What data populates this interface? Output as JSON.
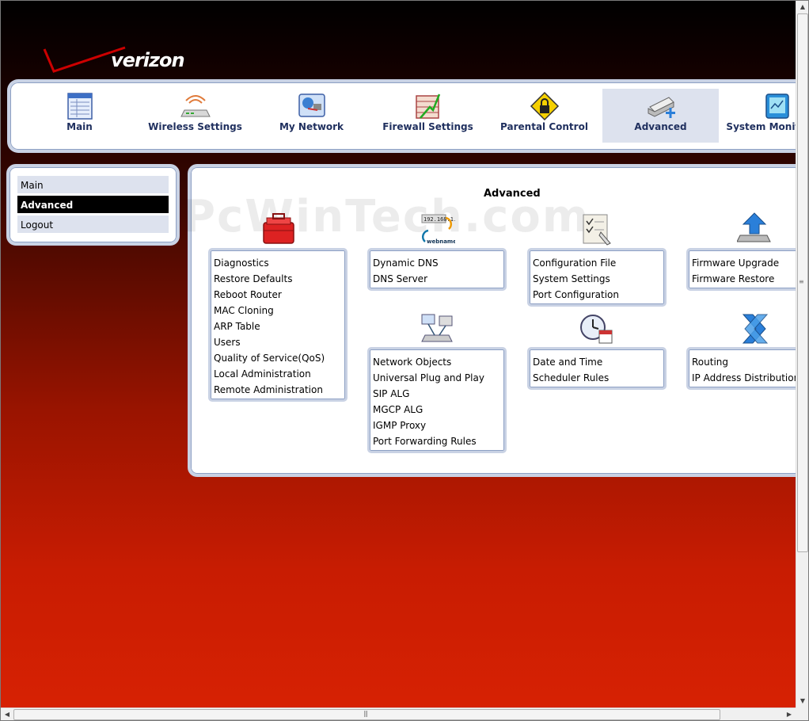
{
  "brand": {
    "name": "verizon"
  },
  "topnav": [
    {
      "label": "Main",
      "icon": "main-table-icon"
    },
    {
      "label": "Wireless Settings",
      "icon": "wireless-router-icon"
    },
    {
      "label": "My Network",
      "icon": "my-network-icon"
    },
    {
      "label": "Firewall Settings",
      "icon": "firewall-icon"
    },
    {
      "label": "Parental Control",
      "icon": "parental-lock-icon"
    },
    {
      "label": "Advanced",
      "icon": "advanced-scanner-icon",
      "active": true
    },
    {
      "label": "System Monitoring",
      "icon": "system-monitor-icon"
    }
  ],
  "sidebar": {
    "items": [
      {
        "label": "Main"
      },
      {
        "label": "Advanced",
        "active": true
      },
      {
        "label": "Logout"
      }
    ]
  },
  "main": {
    "title": "Advanced",
    "watermark": "PcWinTech.com",
    "groups": [
      {
        "icon": "toolbox-icon",
        "links": [
          "Diagnostics",
          "Restore Defaults",
          "Reboot Router",
          "MAC Cloning",
          "ARP Table",
          "Users",
          "Quality of Service(QoS)",
          "Local Administration",
          "Remote Administration"
        ]
      },
      {
        "icon": "dynamic-dns-icon",
        "icon_text": [
          "192.168.1.1",
          "webname"
        ],
        "links": [
          "Dynamic DNS",
          "DNS Server"
        ]
      },
      {
        "icon": "configuration-file-icon",
        "links": [
          "Configuration File",
          "System Settings",
          "Port Configuration"
        ]
      },
      {
        "icon": "firmware-upgrade-icon",
        "links": [
          "Firmware Upgrade",
          "Firmware Restore"
        ]
      },
      {
        "icon": "network-objects-icon",
        "links": [
          "Network Objects",
          "Universal Plug and Play",
          "SIP ALG",
          "MGCP ALG",
          "IGMP Proxy",
          "Port Forwarding Rules"
        ]
      },
      {
        "icon": "date-time-clock-icon",
        "links": [
          "Date and Time",
          "Scheduler Rules"
        ]
      },
      {
        "icon": "routing-icon",
        "links": [
          "Routing",
          "IP Address Distribution"
        ]
      }
    ]
  },
  "colors": {
    "nav_text": "#1f2f5e",
    "panel_border": "#c9d2e4",
    "active_tab_bg": "#dde2ee",
    "background_red": "#d82203"
  }
}
